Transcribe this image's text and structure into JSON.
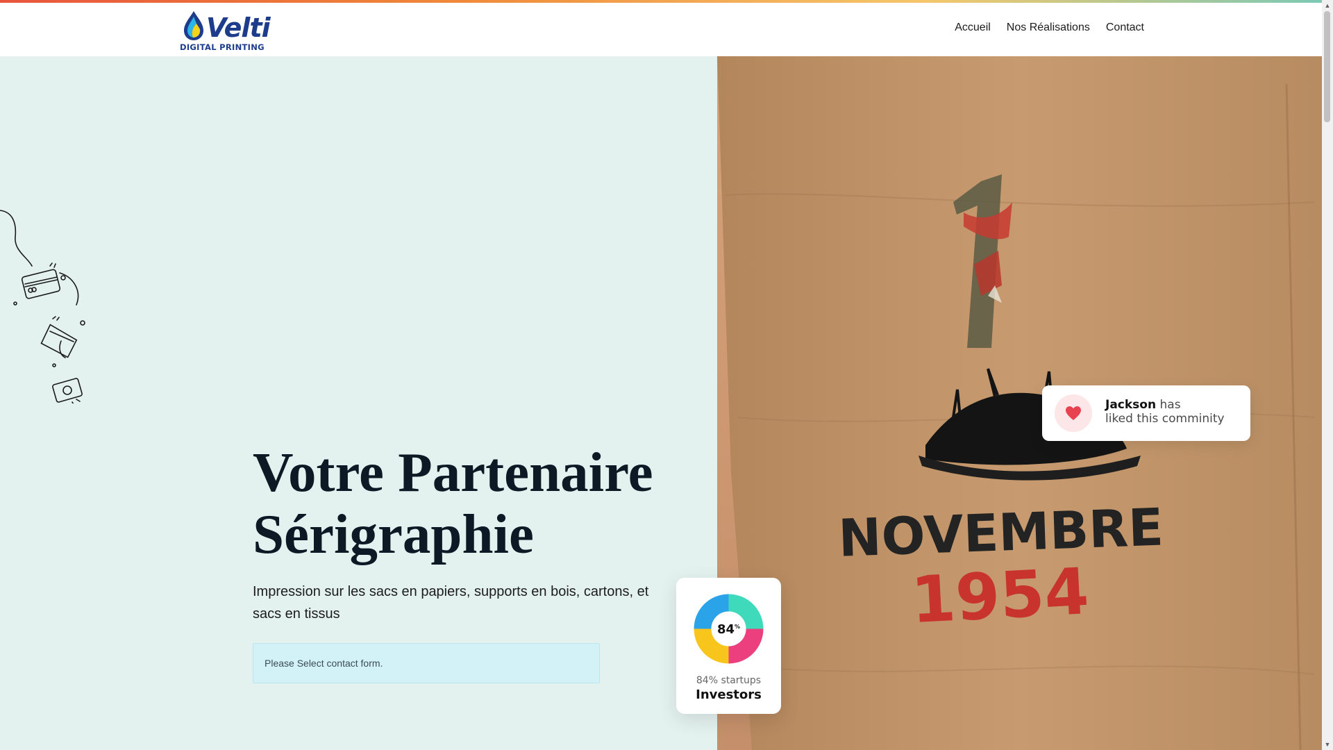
{
  "brand": {
    "name": "Velti",
    "tagline": "DIGITAL PRINTING"
  },
  "nav": {
    "items": [
      {
        "label": "Accueil"
      },
      {
        "label": "Nos Réalisations"
      },
      {
        "label": "Contact"
      }
    ]
  },
  "hero": {
    "title_line1": "Votre Partenaire",
    "title_line2": "Sérigraphie",
    "subtitle": "Impression sur les sacs en papiers, supports en bois, cartons, et sacs en tissus",
    "notice": "Please Select contact form.",
    "photo_text": {
      "line1": "NOVEMBRE",
      "line2": "1954"
    }
  },
  "like_card": {
    "name": "Jackson",
    "text1": "has",
    "text2": "liked this comminity"
  },
  "investors_card": {
    "value": "84",
    "unit": "%",
    "subtitle": "84% startups",
    "title": "Investors"
  },
  "colors": {
    "accent_navy": "#1d3c8c",
    "hero_bg": "#e4f2ef",
    "notice_bg": "#d3f2f8",
    "pink": "#f9b8bd",
    "heart": "#e8414f"
  },
  "icons": {
    "like": "heart-icon",
    "scroll_up": "triangle-up-icon",
    "scroll_down": "triangle-down-icon"
  }
}
